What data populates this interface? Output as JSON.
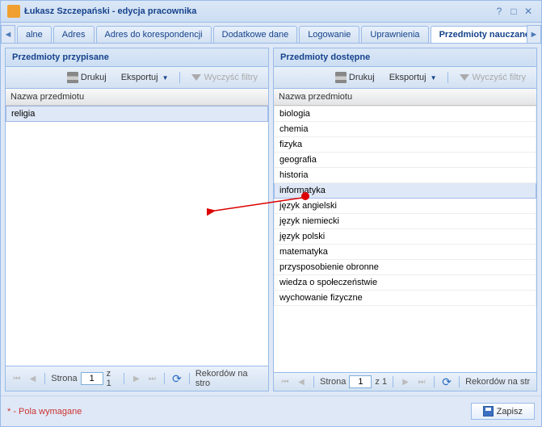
{
  "window": {
    "title": "Łukasz Szczepański - edycja pracownika"
  },
  "tabs": [
    {
      "label": "alne"
    },
    {
      "label": "Adres"
    },
    {
      "label": "Adres do korespondencji"
    },
    {
      "label": "Dodatkowe dane"
    },
    {
      "label": "Logowanie"
    },
    {
      "label": "Uprawnienia"
    },
    {
      "label": "Przedmioty nauczane",
      "active": true
    }
  ],
  "left": {
    "title": "Przedmioty przypisane",
    "print": "Drukuj",
    "export": "Eksportuj",
    "clear": "Wyczyść filtry",
    "colHeader": "Nazwa przedmiotu",
    "rows": [
      {
        "name": "religia",
        "selected": true
      }
    ]
  },
  "right": {
    "title": "Przedmioty dostępne",
    "print": "Drukuj",
    "export": "Eksportuj",
    "clear": "Wyczyść filtry",
    "colHeader": "Nazwa przedmiotu",
    "rows": [
      {
        "name": "biologia"
      },
      {
        "name": "chemia"
      },
      {
        "name": "fizyka"
      },
      {
        "name": "geografia"
      },
      {
        "name": "historia"
      },
      {
        "name": "informatyka",
        "selected": true
      },
      {
        "name": "język angielski"
      },
      {
        "name": "język niemiecki"
      },
      {
        "name": "język polski"
      },
      {
        "name": "matematyka"
      },
      {
        "name": "przysposobienie obronne"
      },
      {
        "name": "wiedza o społeczeństwie"
      },
      {
        "name": "wychowanie fizyczne"
      }
    ]
  },
  "pager": {
    "pageLabel": "Strona",
    "page": "1",
    "of": "z 1",
    "records": "Rekordów na stro"
  },
  "pagerRight": {
    "records": "Rekordów na str"
  },
  "footer": {
    "required": "* - Pola wymagane",
    "save": "Zapisz"
  }
}
